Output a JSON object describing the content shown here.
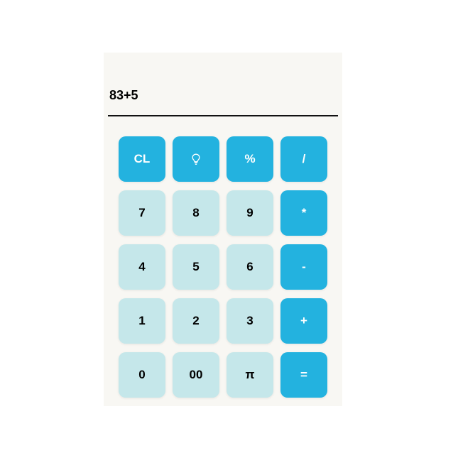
{
  "display": {
    "expression": "83+5"
  },
  "colors": {
    "operator_key": "#23b2df",
    "number_key": "#c5e7ea",
    "background": "#f8f7f3"
  },
  "keys": {
    "row1": [
      "CL",
      "lightbulb-icon",
      "%",
      "/"
    ],
    "row2": [
      "7",
      "8",
      "9",
      "*"
    ],
    "row3": [
      "4",
      "5",
      "6",
      "-"
    ],
    "row4": [
      "1",
      "2",
      "3",
      "+"
    ],
    "row5": [
      "0",
      "00",
      "π",
      "="
    ]
  },
  "labels": {
    "clear": "CL",
    "percent": "%",
    "divide": "/",
    "seven": "7",
    "eight": "8",
    "nine": "9",
    "multiply": "*",
    "four": "4",
    "five": "5",
    "six": "6",
    "minus": "-",
    "one": "1",
    "two": "2",
    "three": "3",
    "plus": "+",
    "zero": "0",
    "double_zero": "00",
    "pi": "π",
    "equals": "="
  }
}
